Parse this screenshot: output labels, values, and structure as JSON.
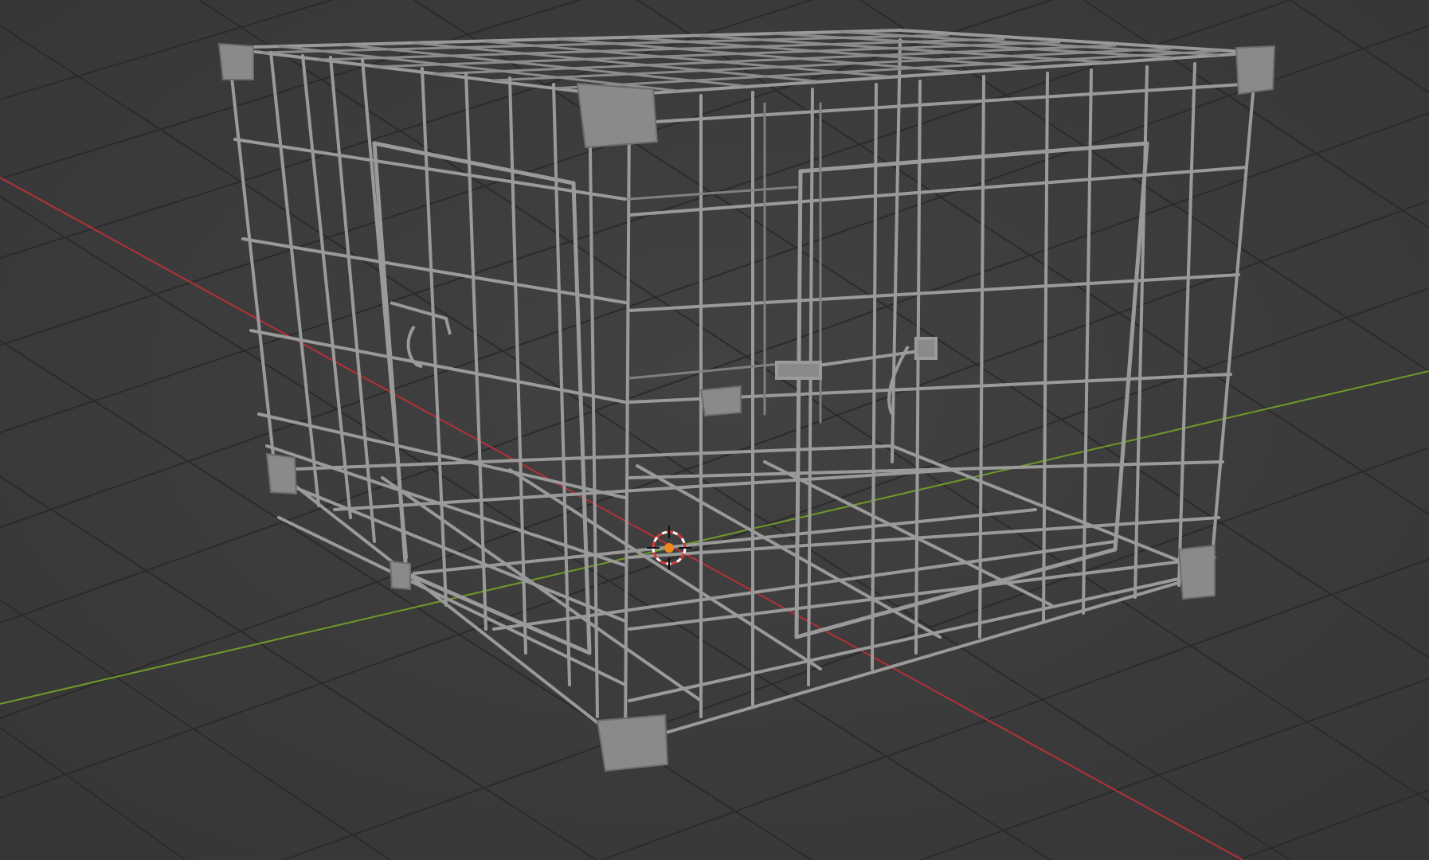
{
  "viewport": {
    "view": "perspective",
    "object": "cage",
    "object_shading": "solid",
    "object_color": "#8f8f8f",
    "background_color": "#3d3d3d",
    "grid_color": "#2b2b2b",
    "x_axis_color": "#b5303a",
    "y_axis_color": "#6f9a2a",
    "cursor_icon": "3d-cursor-icon",
    "origin_icon": "origin-dot-icon"
  }
}
